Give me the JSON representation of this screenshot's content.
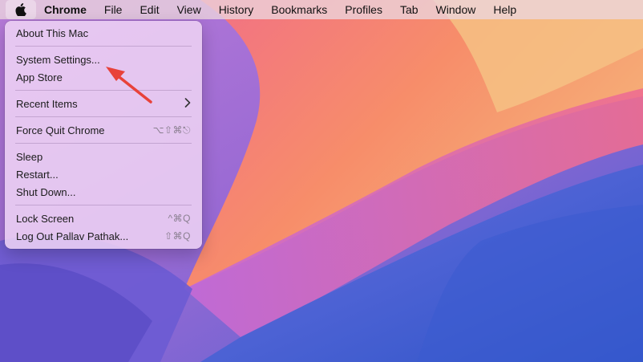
{
  "menubar": {
    "apple_icon": "apple-logo-icon",
    "items": [
      "Chrome",
      "File",
      "Edit",
      "View",
      "History",
      "Bookmarks",
      "Profiles",
      "Tab",
      "Window",
      "Help"
    ]
  },
  "apple_menu": {
    "groups": [
      [
        {
          "label": "About This Mac",
          "shortcut": ""
        }
      ],
      [
        {
          "label": "System Settings...",
          "shortcut": ""
        },
        {
          "label": "App Store",
          "shortcut": ""
        }
      ],
      [
        {
          "label": "Recent Items",
          "submenu": true,
          "shortcut": ""
        }
      ],
      [
        {
          "label": "Force Quit Chrome",
          "shortcut": "⌥⇧⌘⎋"
        }
      ],
      [
        {
          "label": "Sleep",
          "shortcut": ""
        },
        {
          "label": "Restart...",
          "shortcut": ""
        },
        {
          "label": "Shut Down...",
          "shortcut": ""
        }
      ],
      [
        {
          "label": "Lock Screen",
          "shortcut": "^⌘Q"
        },
        {
          "label": "Log Out Pallav Pathak...",
          "shortcut": "⇧⌘Q"
        }
      ]
    ]
  },
  "annotation": {
    "arrow_color": "#e8423a",
    "points_to": "System Settings..."
  },
  "colors": {
    "wallpaper_coral": "#f48a68",
    "wallpaper_purple": "#7b5cd6",
    "wallpaper_blue": "#3c56c8"
  }
}
